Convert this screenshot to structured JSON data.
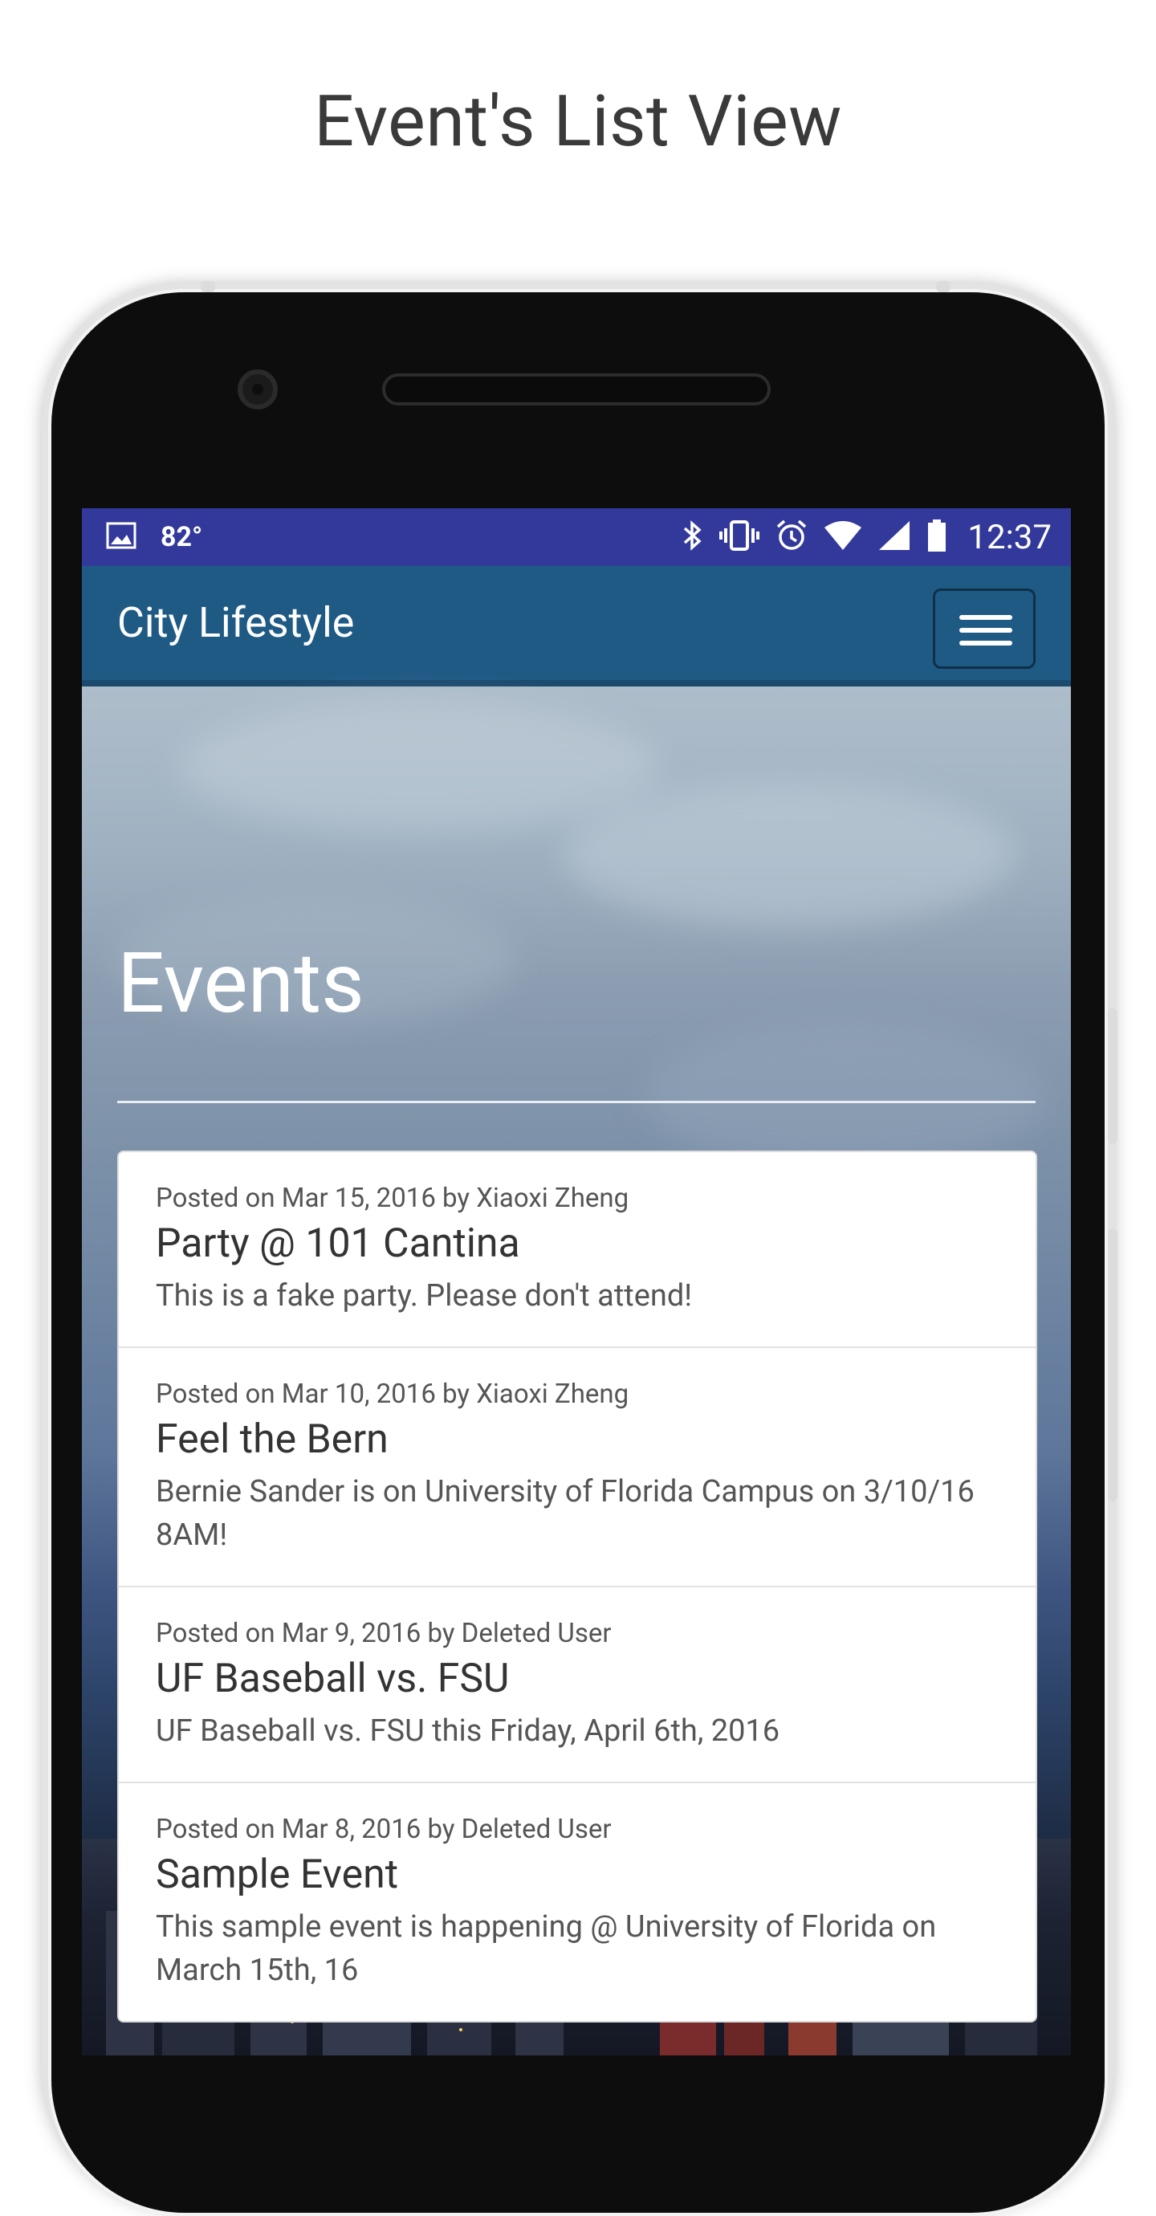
{
  "page": {
    "title": "Event's List View"
  },
  "status_bar": {
    "image_icon": "image-icon",
    "temperature": "82°",
    "time": "12:37",
    "icons": [
      "bluetooth-icon",
      "vibrate-icon",
      "alarm-icon",
      "wifi-icon",
      "signal-icon",
      "battery-icon"
    ]
  },
  "navbar": {
    "brand": "City Lifestyle",
    "menu_icon": "hamburger-menu-icon"
  },
  "main": {
    "heading": "Events",
    "events": [
      {
        "meta": "Posted on Mar 15, 2016 by Xiaoxi Zheng",
        "title": "Party @ 101 Cantina",
        "description": "This is a fake party. Please don't attend!"
      },
      {
        "meta": "Posted on Mar 10, 2016 by Xiaoxi Zheng",
        "title": "Feel the Bern",
        "description": "Bernie Sander is on University of Florida Campus on 3/10/16 8AM!"
      },
      {
        "meta": "Posted on Mar 9, 2016 by Deleted User",
        "title": "UF Baseball vs. FSU",
        "description": "UF Baseball vs. FSU this Friday, April 6th, 2016"
      },
      {
        "meta": "Posted on Mar 8, 2016 by Deleted User",
        "title": "Sample Event",
        "description": "This sample event is happening @ University of Florida on March 15th, 16"
      }
    ]
  },
  "colors": {
    "status_bar": "#33399b",
    "navbar": "#1f5a85",
    "page_background": "#ffffff"
  }
}
